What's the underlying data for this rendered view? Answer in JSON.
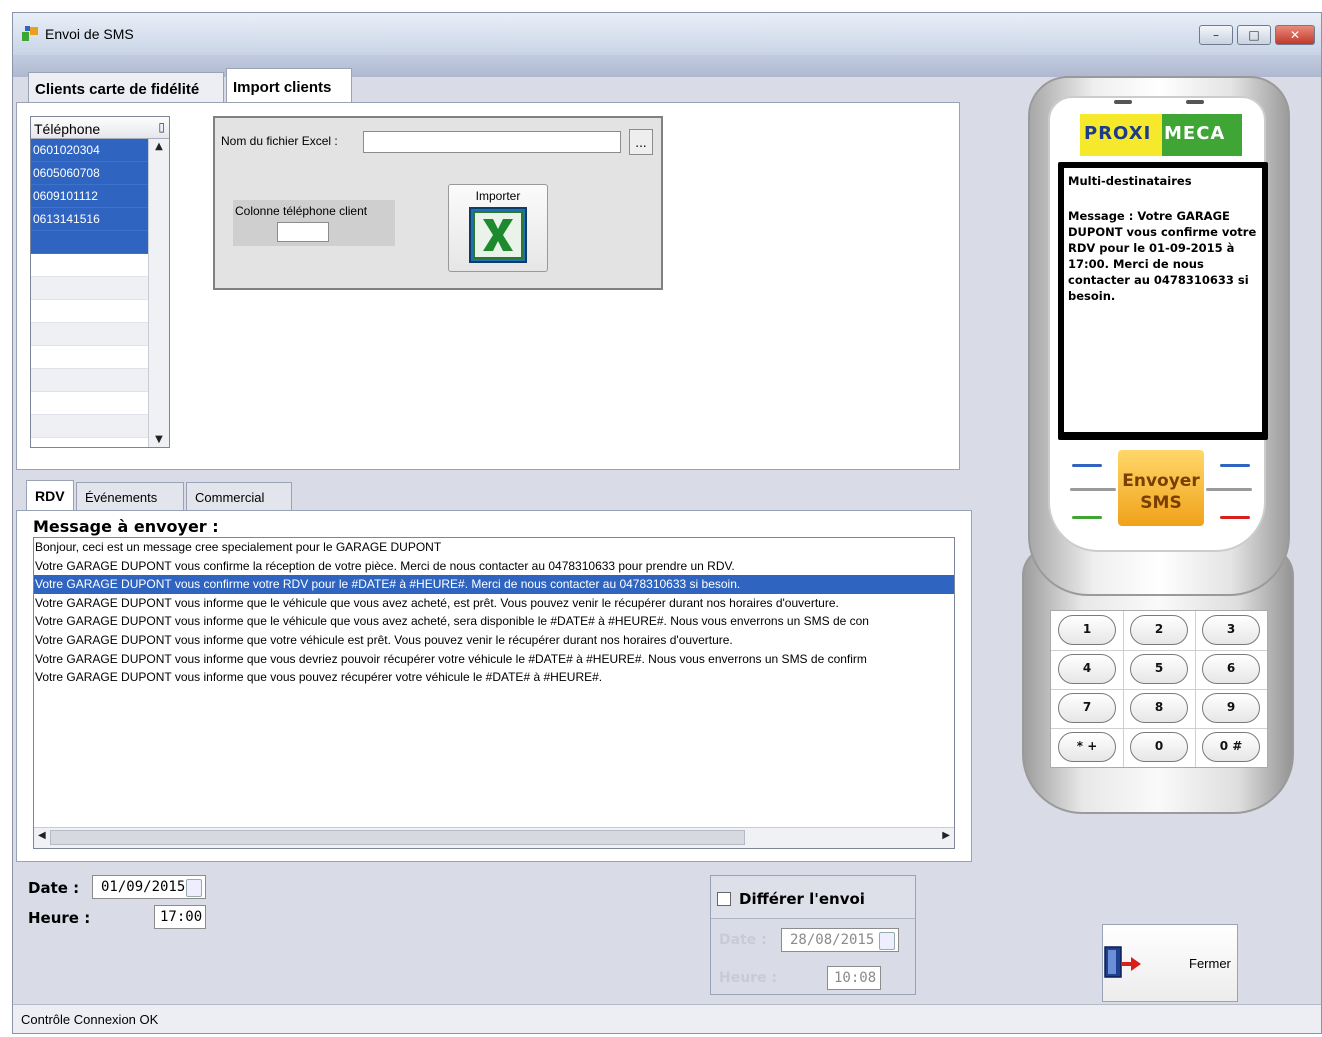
{
  "window": {
    "title": "Envoi de SMS",
    "controls": {
      "minimize": "–",
      "maximize": "□",
      "close": "✕"
    }
  },
  "top_tabs": [
    {
      "label": "Clients carte de fidélité",
      "active": false
    },
    {
      "label": "Import clients",
      "active": true
    }
  ],
  "phone_grid": {
    "header": "Téléphone",
    "rows": [
      "0601020304",
      "0605060708",
      "0609101112",
      "0613141516"
    ]
  },
  "import": {
    "file_label": "Nom du fichier Excel :",
    "file_value": "",
    "browse_label": "...",
    "column_label": "Colonne téléphone client",
    "column_value": "",
    "import_button_label": "Importer"
  },
  "message_tabs": [
    {
      "label": "RDV",
      "active": true
    },
    {
      "label": "Événements",
      "active": false
    },
    {
      "label": "Commercial",
      "active": false
    }
  ],
  "messages": {
    "label": "Message à envoyer :",
    "selected_index": 2,
    "items": [
      "Bonjour, ceci est un message cree specialement pour le GARAGE DUPONT",
      "Votre GARAGE DUPONT vous confirme la réception de votre pièce. Merci de nous contacter au 0478310633 pour prendre un RDV.",
      "Votre GARAGE DUPONT vous confirme votre RDV pour le #DATE# à #HEURE#. Merci de nous contacter au 0478310633 si besoin.",
      "Votre GARAGE DUPONT vous informe que le véhicule que vous avez acheté, est prêt. Vous pouvez venir le récupérer durant nos horaires d'ouverture.",
      "Votre GARAGE DUPONT vous informe que le véhicule que vous avez acheté, sera disponible le #DATE# à #HEURE#. Nous vous enverrons un SMS de con",
      "Votre GARAGE DUPONT vous informe que votre véhicule est prêt. Vous pouvez venir le récupérer durant nos horaires d'ouverture.",
      "Votre GARAGE DUPONT vous informe que vous devriez pouvoir récupérer votre véhicule le #DATE# à #HEURE#. Nous vous enverrons un SMS de confirm",
      "Votre GARAGE DUPONT vous informe que vous pouvez récupérer votre véhicule le #DATE# à #HEURE#."
    ]
  },
  "schedule": {
    "date_label": "Date :",
    "date_value": "01/09/2015",
    "time_label": "Heure :",
    "time_value": "17:00"
  },
  "defer": {
    "checkbox_label": "Différer l'envoi",
    "checked": false,
    "date_label": "Date :",
    "date_value": "28/08/2015",
    "time_label": "Heure :",
    "time_value": "10:08"
  },
  "phone": {
    "brand_left": "PROXI",
    "brand_right": "MECA",
    "screen_title": "Multi-destinataires",
    "screen_message": "Message : Votre GARAGE DUPONT vous confirme votre RDV pour le 01-09-2015 à 17:00. Merci de nous contacter au 0478310633 si besoin.",
    "send_line1": "Envoyer",
    "send_line2": "SMS",
    "keys": [
      "1",
      "2",
      "3",
      "4",
      "5",
      "6",
      "7",
      "8",
      "9",
      "* +",
      "0",
      "0 #"
    ]
  },
  "close_button": {
    "label": "Fermer"
  },
  "status": {
    "text": "Contrôle Connexion OK"
  },
  "colors": {
    "selection": "#2f65c0",
    "brand_green": "#3fa535",
    "send_orange": "#f0a21a"
  }
}
